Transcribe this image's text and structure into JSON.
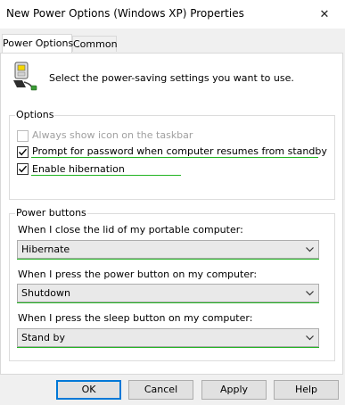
{
  "window": {
    "title": "New Power Options (Windows XP) Properties",
    "close_glyph": "✕"
  },
  "tabs": [
    {
      "label": "Power Options",
      "active": true
    },
    {
      "label": "Common",
      "active": false
    }
  ],
  "intro": {
    "text": "Select the power-saving settings you want to use.",
    "icon": "power-options-icon"
  },
  "options_group": {
    "title": "Options",
    "items": [
      {
        "label": "Always show icon on the taskbar",
        "checked": false,
        "enabled": false
      },
      {
        "label": "Prompt for password when computer resumes from standby",
        "checked": true,
        "enabled": true
      },
      {
        "label": "Enable hibernation",
        "checked": true,
        "enabled": true
      }
    ]
  },
  "power_buttons_group": {
    "title": "Power buttons",
    "lid": {
      "label": "When I close the lid of my portable computer:",
      "value": "Hibernate"
    },
    "power": {
      "label": "When I press the power button on my computer:",
      "value": "Shutdown"
    },
    "sleep": {
      "label": "When I press the sleep button on my computer:",
      "value": "Stand by"
    }
  },
  "buttons": {
    "ok": "OK",
    "cancel": "Cancel",
    "apply": "Apply",
    "help": "Help"
  },
  "colors": {
    "accent": "#0078d7",
    "highlight_line": "#22b422",
    "disabled_text": "#a0a0a0"
  }
}
